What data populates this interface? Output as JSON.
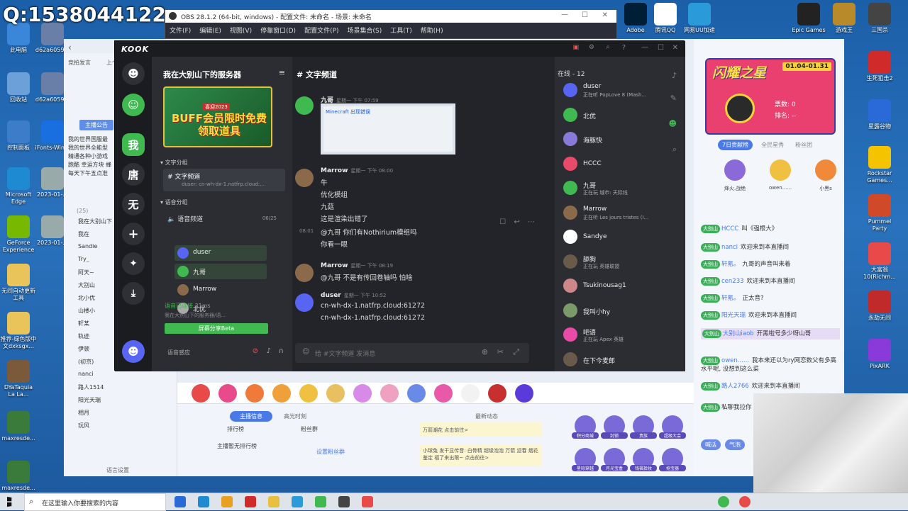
{
  "overlay": {
    "qq_number": "Q:1538044122"
  },
  "desktop_icons_left": [
    {
      "label": "此电脑",
      "color": "#3a86d8"
    },
    {
      "label": "d62a6059...",
      "color": "#6a7fa8"
    },
    {
      "label": "回收站",
      "color": "#6ca0d8"
    },
    {
      "label": "d62a6059...",
      "color": "#6a7fa8"
    },
    {
      "label": "控制面板",
      "color": "#3d7cc9"
    },
    {
      "label": "iFonts-Win...",
      "color": "#1a6fe0"
    },
    {
      "label": "Microsoft Edge",
      "color": "#1d8ad1"
    },
    {
      "label": "2023-01-...",
      "color": "#9aa"
    },
    {
      "label": "GeForce Experience",
      "color": "#76b900"
    },
    {
      "label": "2023-01-...",
      "color": "#9aa"
    },
    {
      "label": "无间自动更新工具",
      "color": "#e8c45a"
    },
    {
      "label": "推荐-绿色版中文dxksgx...",
      "color": "#e8c45a"
    },
    {
      "label": "DYaTaquia La La...",
      "color": "#7a5a3a"
    },
    {
      "label": "maxresde...",
      "color": "#3a7a3a"
    },
    {
      "label": "maxresde...",
      "color": "#3a7a3a"
    }
  ],
  "desktop_icons_right": [
    {
      "label": "Epic Games",
      "color": "#222"
    },
    {
      "label": "游戏王",
      "color": "#b88a2a"
    },
    {
      "label": "三国杀",
      "color": "#444"
    },
    {
      "label": "Adobe",
      "color": "#001e36"
    },
    {
      "label": "腾讯QQ",
      "color": "#fff"
    },
    {
      "label": "网易UU加速",
      "color": "#2a9ad8"
    },
    {
      "label": "生死狙击2",
      "color": "#d02a2a"
    },
    {
      "label": "星露谷物",
      "color": "#2a6ad8"
    },
    {
      "label": "Rockstar Games...",
      "color": "#f5c400"
    },
    {
      "label": "Pummel Party",
      "color": "#d04a2a"
    },
    {
      "label": "大富翁10(Richm...",
      "color": "#e84a4a"
    },
    {
      "label": "永劫无间",
      "color": "#c02a2a"
    },
    {
      "label": "PixARK",
      "color": "#8a3ad8"
    }
  ],
  "obs": {
    "title": "OBS 28.1.2 (64-bit, windows) - 配置文件: 未命名 - 场景: 未命名",
    "menu": [
      "文件(F)",
      "编辑(E)",
      "视图(V)",
      "停靠窗口(D)",
      "配置文件(P)",
      "场景集合(S)",
      "工具(T)",
      "帮助(H)"
    ]
  },
  "kook": {
    "logo": "KOOK",
    "rail": [
      {
        "label": "我",
        "color": "#3fb950"
      },
      {
        "label": "唐",
        "color": "#2e3036"
      },
      {
        "label": "无",
        "color": "#2e3036"
      }
    ],
    "server_name": "我在大别山下的服务器",
    "banner_text": "BUFF会员限时免费领取道具",
    "banner_sub": "喜迎2023",
    "categories": [
      {
        "label": "文字分组"
      },
      {
        "label": "语音分组"
      }
    ],
    "text_channel": {
      "name": "文字频道",
      "preview": "duser: cn-wh-dx-1.natfrp.cloud:..."
    },
    "voice_channel": {
      "name": "语音频道",
      "count": "06/25"
    },
    "voice_members": [
      "duser",
      "九哥",
      "Marrow",
      "北优"
    ],
    "voice_status": {
      "label": "语音已连接",
      "ping": "31ms",
      "server": "我在大别山下的服务器/语..."
    },
    "share_button": "屏幕分享Beta",
    "voice_sensing": "语音感应",
    "channel_title": "文字频道",
    "messages": [
      {
        "name": "九哥",
        "time": "星期一 下午 07:59",
        "lines": [],
        "image_title": "Minecraft 出现错误"
      },
      {
        "name": "Marrow",
        "time": "星期一 下午 08:00",
        "lines": [
          "牛",
          "优化模组",
          "九菇",
          "这是渲染出错了"
        ]
      },
      {
        "name": "",
        "time": "08:01",
        "lines": [
          "@九哥 你们有Nothirium模组吗",
          "你看一眼"
        ]
      },
      {
        "name": "Marrow",
        "time": "星期一 下午 08:19",
        "lines": [
          "@九哥 不是有传回卷轴吗 怕啥"
        ]
      },
      {
        "name": "duser",
        "time": "星期一 下午 10:52",
        "lines": [
          "cn-wh-dx-1.natfrp.cloud:61272",
          "cn-wh-dx-1.natfrp.cloud:61272"
        ]
      }
    ],
    "input_placeholder": "给 #文字频道 发消息",
    "online_label": "在线 - 12",
    "members": [
      {
        "name": "duser",
        "status": "正在听 PopLove 8 (Mash...",
        "color": "#5865f2"
      },
      {
        "name": "北优",
        "status": "",
        "color": "#3fb950"
      },
      {
        "name": "海豚快",
        "status": "",
        "color": "#8a7ad8"
      },
      {
        "name": "HCCC",
        "status": "",
        "color": "#e84a6a"
      },
      {
        "name": "九哥",
        "status": "正在玩 城市: 天际线",
        "color": "#3fb950"
      },
      {
        "name": "Marrow",
        "status": "正在听 Les jours tristes (I...",
        "color": "#8a6a4a"
      },
      {
        "name": "Sandye",
        "status": "",
        "color": "#fff"
      },
      {
        "name": "舔狗",
        "status": "正在玩 英雄联盟",
        "color": "#6a5a4a"
      },
      {
        "name": "Tsukinousag1",
        "status": "",
        "color": "#c88"
      },
      {
        "name": "我叫小hy",
        "status": "",
        "color": "#7a9a6a"
      },
      {
        "name": "吧语",
        "status": "正在玩 Apex 英雄",
        "color": "#e84aa8"
      },
      {
        "name": "在下今麦郎",
        "status": "",
        "color": "#6a5a4a"
      }
    ]
  },
  "live_left": {
    "tabs": [
      "竞拍发言",
      "上个..."
    ],
    "notice_button": "主播公告",
    "notice": [
      "我的世界国服最",
      "我的世界全能型",
      "精通各种小游戏",
      "跑酷 幸运方块 蜂",
      "每天下午五点准"
    ],
    "users_count": "(25)",
    "users": [
      "我在大别山下",
      "我在",
      "Sandie",
      "Try_",
      "阿天~",
      "大别山",
      "北小优",
      "山楼小",
      "轩某",
      "轨迹",
      "伊顿",
      "(初京)",
      "nanci",
      "路人1514",
      "阳光天瑞",
      "相月",
      "玩风"
    ],
    "footer": "语言设置"
  },
  "live_right": {
    "event_title": "闪耀之星",
    "event_date": "01.04-01.31",
    "votes": "票数: 0",
    "rank": "排名: --",
    "tabs": [
      "7日贡献榜",
      "全民星秀",
      "粉丝团"
    ],
    "ranked": [
      "烽火.战绝",
      "owen......",
      "小黑s"
    ],
    "chat": [
      {
        "user": "HCCC",
        "text": "叫《强根大》"
      },
      {
        "user": "nanci",
        "text": "欢迎来到本直播间"
      },
      {
        "user": "轩氪。",
        "text": "九哥的声音叫来着"
      },
      {
        "user": "cen233",
        "text": "欢迎来到本直播间"
      },
      {
        "user": "轩氪。",
        "text": "正太音?"
      },
      {
        "user": "阳光天瑞",
        "text": "欢迎来到本直播间"
      },
      {
        "user": "大别山iaob",
        "text": "开黑啦号多少呀山哥"
      },
      {
        "user": "owen......",
        "text": "我本来还以为ry网恋数父有多高水平呢, 没想到这么菜"
      },
      {
        "user": "路人2766",
        "text": "欢迎来到本直播间"
      },
      {
        "user": "",
        "text": "私聊我拉你"
      }
    ],
    "bottom_tabs": [
      "喊话",
      "气泡"
    ]
  },
  "live_bottom": {
    "tabs": [
      "主播信息",
      "高光时刻",
      "最新动态"
    ],
    "rank_label": "排行榜",
    "fans_label": "粉丝群",
    "no_rank": "主播暂无排行榜",
    "fans_link": "设置粉丝群",
    "news1": "万箭潮花 点击前往>",
    "news2": "小球兔 发干显传音: 白骨精 超级泡泡 万箭 迎春 烟花 鉴定 福了来出限~ 点击前往>",
    "features": [
      "积分商城",
      "封锁",
      "贵族",
      "超级大会",
      "星际穿越",
      "月光宝盒",
      "钱福拾妆",
      "抢宝器"
    ]
  },
  "taskbar": {
    "search": "在这里输入你要搜索的内容"
  }
}
